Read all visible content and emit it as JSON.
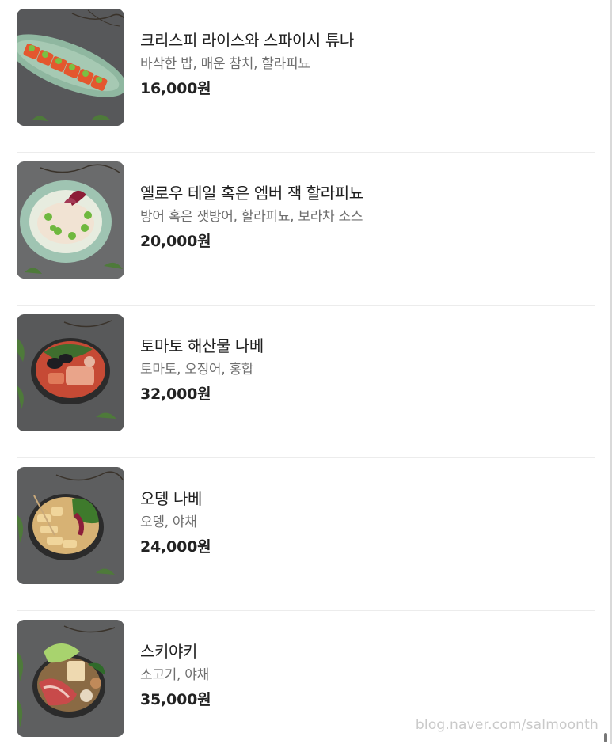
{
  "menu": {
    "items": [
      {
        "name": "크리스피 라이스와 스파이시 튜나",
        "description": "바삭한 밥, 매운 참치, 할라피뇨",
        "price": "16,000원",
        "image": "crispy-rice-tuna-photo"
      },
      {
        "name": "옐로우 테일 혹은 엠버 잭 할라피뇨",
        "description": "방어 혹은 잿방어, 할라피뇨, 보라차 소스",
        "price": "20,000원",
        "image": "yellowtail-jalapeno-photo"
      },
      {
        "name": "토마토 해산물 나베",
        "description": "토마토, 오징어, 홍합",
        "price": "32,000원",
        "image": "tomato-seafood-nabe-photo"
      },
      {
        "name": "오뎅 나베",
        "description": "오뎅, 야채",
        "price": "24,000원",
        "image": "oden-nabe-photo"
      },
      {
        "name": "스키야키",
        "description": "소고기, 야채",
        "price": "35,000원",
        "image": "sukiyaki-photo"
      }
    ]
  },
  "watermark": "blog.naver.com/salmoonth"
}
